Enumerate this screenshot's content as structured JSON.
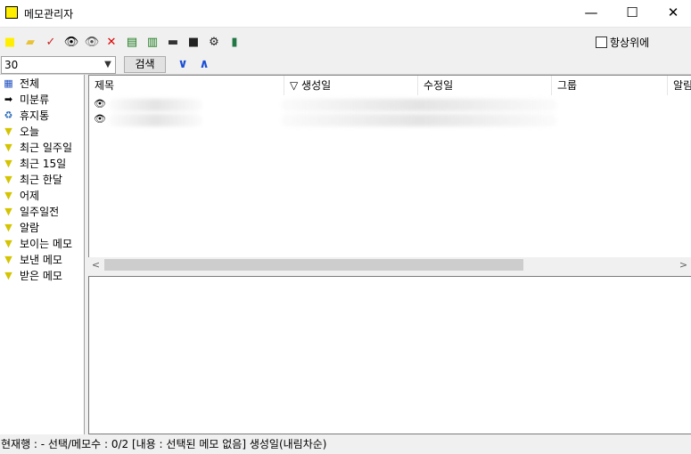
{
  "window": {
    "title": "메모관리자",
    "controls": {
      "minimize": "—",
      "maximize": "☐",
      "close": "✕"
    }
  },
  "toolbar": {
    "icons": [
      {
        "name": "new-memo-icon",
        "glyph": "■",
        "color": "#ffee00"
      },
      {
        "name": "open-folder-icon",
        "glyph": "▰",
        "color": "#e8c33a"
      },
      {
        "name": "select-all-icon",
        "glyph": "✓",
        "color": "#cc2222"
      },
      {
        "name": "show-icon",
        "glyph": "👁",
        "color": "#000000"
      },
      {
        "name": "hide-icon",
        "glyph": "👁",
        "color": "#555555"
      },
      {
        "name": "delete-icon",
        "glyph": "✕",
        "color": "#dd0000"
      },
      {
        "name": "export-icon",
        "glyph": "▤",
        "color": "#1a7a1a"
      },
      {
        "name": "import-icon",
        "glyph": "▥",
        "color": "#1a7a1a"
      },
      {
        "name": "print-icon",
        "glyph": "▬",
        "color": "#333333"
      },
      {
        "name": "save-icon",
        "glyph": "■",
        "color": "#222222"
      },
      {
        "name": "settings-gear-icon",
        "glyph": "⚙",
        "color": "#222222"
      },
      {
        "name": "exit-icon",
        "glyph": "▮",
        "color": "#227744"
      }
    ],
    "always_on_top_label": "항상위에",
    "always_on_top_checked": false
  },
  "search": {
    "count_value": "30",
    "search_button_label": "검색",
    "down_arrow": "∨",
    "up_arrow": "∧"
  },
  "sidebar": {
    "items": [
      {
        "label": "전체",
        "icon": "all-icon",
        "glyph": "▦",
        "color": "#1f4fbf"
      },
      {
        "label": "미분류",
        "icon": "unclassified-icon",
        "glyph": "➡",
        "color": "#000000"
      },
      {
        "label": "휴지통",
        "icon": "trash-icon",
        "glyph": "♻",
        "color": "#2a6bb8"
      },
      {
        "label": "오늘",
        "icon": "filter-icon",
        "glyph": "▼",
        "color": "#d4c400"
      },
      {
        "label": "최근 일주일",
        "icon": "filter-icon",
        "glyph": "▼",
        "color": "#d4c400"
      },
      {
        "label": "최근 15일",
        "icon": "filter-icon",
        "glyph": "▼",
        "color": "#d4c400"
      },
      {
        "label": "최근 한달",
        "icon": "filter-icon",
        "glyph": "▼",
        "color": "#d4c400"
      },
      {
        "label": "어제",
        "icon": "filter-icon",
        "glyph": "▼",
        "color": "#d4c400"
      },
      {
        "label": "일주일전",
        "icon": "filter-icon",
        "glyph": "▼",
        "color": "#d4c400"
      },
      {
        "label": "알람",
        "icon": "filter-icon",
        "glyph": "▼",
        "color": "#d4c400"
      },
      {
        "label": "보이는 메모",
        "icon": "filter-icon",
        "glyph": "▼",
        "color": "#d4c400"
      },
      {
        "label": "보낸 메모",
        "icon": "filter-icon",
        "glyph": "▼",
        "color": "#d4c400"
      },
      {
        "label": "받은 메모",
        "icon": "filter-icon",
        "glyph": "▼",
        "color": "#d4c400"
      }
    ]
  },
  "list": {
    "columns": [
      {
        "label": "제목"
      },
      {
        "label": "▽  생성일"
      },
      {
        "label": "수정일"
      },
      {
        "label": "그룹"
      },
      {
        "label": "알림"
      }
    ],
    "rows": [
      {
        "icon": "eye-icon",
        "glyph": "👁"
      },
      {
        "icon": "eye-icon",
        "glyph": "👁"
      }
    ],
    "scroll_left": "<",
    "scroll_right": ">"
  },
  "status": {
    "text": "현재행 : -   선택/메모수 : 0/2  [내용 : 선택된 메모 없음]   생성일(내림차순)"
  }
}
